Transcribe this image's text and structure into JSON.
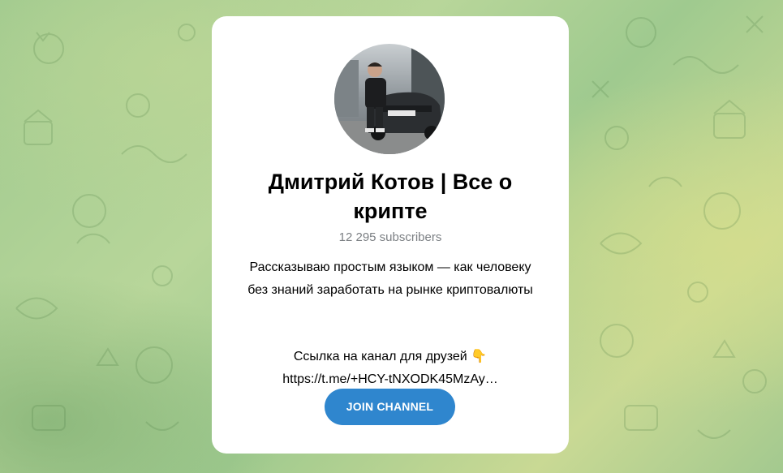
{
  "channel": {
    "title": "Дмитрий Котов | Все о крипте",
    "subscribers": "12 295 subscribers",
    "description": "Рассказываю простым языком — как человеку\nбез знаний заработать на рынке криптовалюты",
    "link_label": "Ссылка на канал для друзей 👇",
    "link_url": "https://t.me/+HCY-tNXODK45MzAy…",
    "avatar_icon": "channel-avatar-photo"
  },
  "actions": {
    "join_label": "JOIN CHANNEL"
  },
  "colors": {
    "button": "#2f86ce",
    "card": "#ffffff",
    "subtitle": "#7b7f83"
  }
}
